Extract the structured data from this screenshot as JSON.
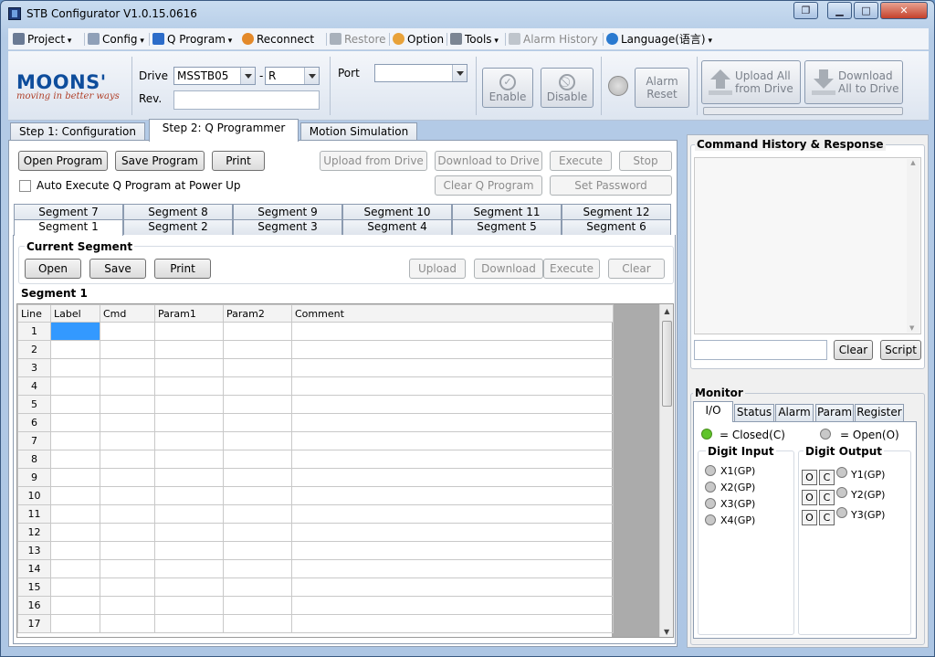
{
  "window": {
    "title": "STB Configurator V1.0.15.0616"
  },
  "menu": [
    {
      "label": "Project",
      "icon": "project-icon",
      "dropdown": true,
      "disabled": false
    },
    {
      "label": "Config",
      "icon": "config-icon",
      "dropdown": true,
      "disabled": false
    },
    {
      "label": "Q Program",
      "icon": "q-program-icon",
      "dropdown": true,
      "disabled": false
    },
    {
      "label": "Reconnect",
      "icon": "reconnect-icon",
      "dropdown": false,
      "disabled": false
    },
    {
      "label": "Restore",
      "icon": "restore-icon",
      "dropdown": false,
      "disabled": true
    },
    {
      "label": "Option",
      "icon": "option-icon",
      "dropdown": false,
      "disabled": false
    },
    {
      "label": "Tools",
      "icon": "tools-icon",
      "dropdown": true,
      "disabled": false
    },
    {
      "label": "Alarm History",
      "icon": "alarm-icon",
      "dropdown": false,
      "disabled": true
    },
    {
      "label": "Language(语言)",
      "icon": "globe-icon",
      "dropdown": true,
      "disabled": false
    }
  ],
  "logo": {
    "brand": "MOONS'",
    "tagline": "moving in better ways"
  },
  "toolbar": {
    "drive_label": "Drive",
    "drive_value": "MSSTB05",
    "dash": "-",
    "suffix_value": "R",
    "rev_label": "Rev.",
    "rev_value": "",
    "port_label": "Port",
    "port_value": "",
    "enable_label": "Enable",
    "disable_label": "Disable",
    "alarm_reset_label": "Alarm\nReset",
    "upload_all_label": "Upload All\nfrom Drive",
    "download_all_label": "Download\nAll to Drive"
  },
  "main_tabs": [
    "Step 1: Configuration",
    "Step 2: Q Programmer",
    "Motion Simulation"
  ],
  "program_buttons": {
    "open": "Open Program",
    "save": "Save Program",
    "print": "Print",
    "upload": "Upload from Drive",
    "download": "Download to Drive",
    "execute": "Execute",
    "stop": "Stop",
    "clear_q": "Clear Q Program",
    "set_password": "Set Password"
  },
  "auto_execute_label": "Auto Execute Q Program at Power Up",
  "segment_tabs_back": [
    "Segment 7",
    "Segment 8",
    "Segment 9",
    "Segment 10",
    "Segment 11",
    "Segment 12"
  ],
  "segment_tabs_front": [
    "Segment 1",
    "Segment 2",
    "Segment 3",
    "Segment 4",
    "Segment 5",
    "Segment 6"
  ],
  "current_segment": {
    "title": "Current Segment",
    "open": "Open",
    "save": "Save",
    "print": "Print",
    "upload": "Upload",
    "download": "Download",
    "execute": "Execute",
    "clear": "Clear"
  },
  "segment_title": "Segment 1",
  "grid": {
    "columns": [
      "Line",
      "Label",
      "Cmd",
      "Param1",
      "Param2",
      "Comment"
    ],
    "rows": [
      "1",
      "2",
      "3",
      "4",
      "5",
      "6",
      "7",
      "8",
      "9",
      "10",
      "11",
      "12",
      "13",
      "14",
      "15",
      "16",
      "17"
    ]
  },
  "history": {
    "title": "Command History & Response",
    "clear": "Clear",
    "script": "Script"
  },
  "monitor": {
    "title": "Monitor",
    "tabs": [
      "I/O",
      "Status",
      "Alarm",
      "Param",
      "Register"
    ],
    "closed_label": "= Closed(C)",
    "open_label": "= Open(O)",
    "closed_color": "#5fc42a",
    "digit_input_title": "Digit Input",
    "digit_output_title": "Digit Output",
    "inputs": [
      "X1(GP)",
      "X2(GP)",
      "X3(GP)",
      "X4(GP)"
    ],
    "outputs": [
      "Y1(GP)",
      "Y2(GP)",
      "Y3(GP)"
    ],
    "o_label": "O",
    "c_label": "C"
  }
}
